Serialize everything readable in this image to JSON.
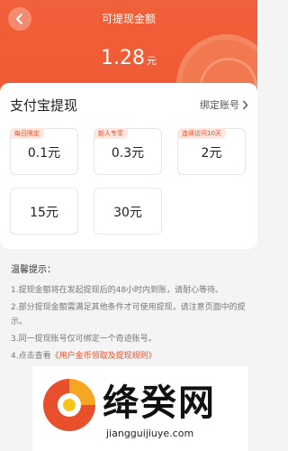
{
  "header": {
    "title": "可提现金额",
    "amount": "1.28",
    "unit": "元"
  },
  "card": {
    "title": "支付宝提现",
    "bind_link": "绑定账号",
    "options": [
      {
        "tag": "每日限定",
        "value": "0.1元"
      },
      {
        "tag": "新人专享",
        "value": "0.3元"
      },
      {
        "tag": "连续访问10天",
        "value": "2元"
      },
      {
        "tag": "",
        "value": "15元"
      },
      {
        "tag": "",
        "value": "30元"
      }
    ]
  },
  "tips": {
    "title": "温馨提示：",
    "items": [
      "1.提现金额将在发起提现后的48小时内到账，请耐心等待。",
      "2.部分提现金额需满足其他条件才可使用提现，请注意页面中的提示。",
      "3.同一提现账号仅可绑定一个奇迹账号。",
      "4.点击查看"
    ],
    "rule_link": "《用户金币领取及提现规则》"
  },
  "watermark": {
    "text": "绛癸网",
    "url": "jiangguijiuye.com"
  }
}
